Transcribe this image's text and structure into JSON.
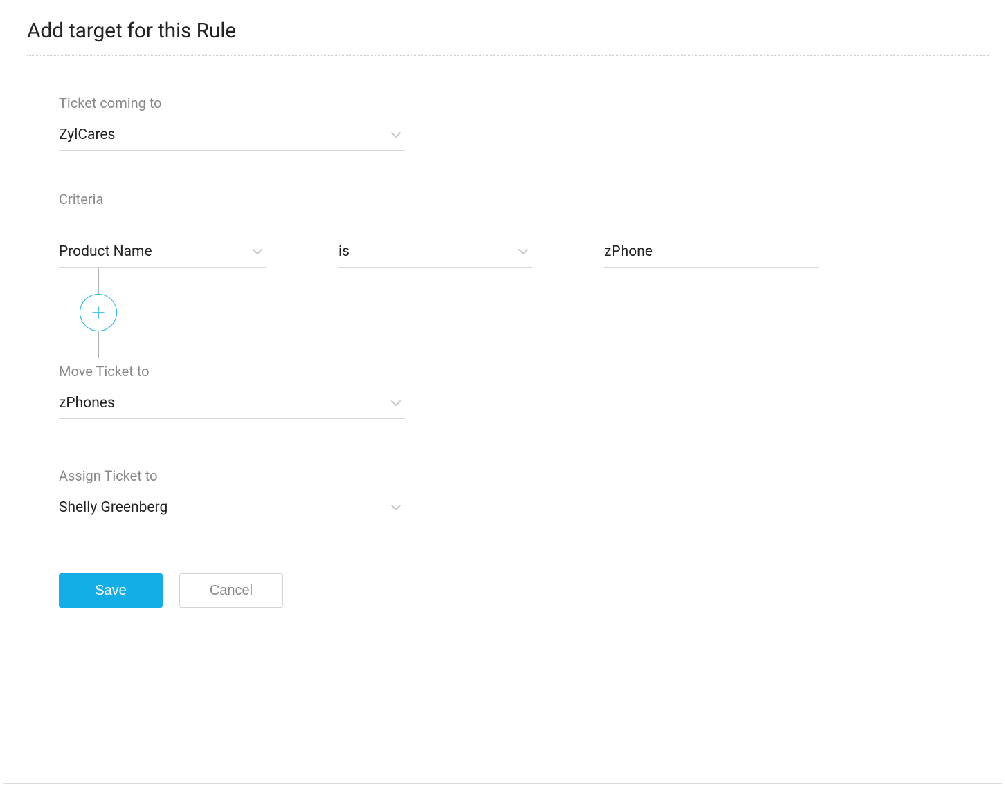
{
  "header": {
    "title": "Add target for this Rule"
  },
  "ticket_coming": {
    "label": "Ticket coming to",
    "value": "ZylCares"
  },
  "criteria": {
    "label": "Criteria",
    "field": "Product Name",
    "operator": "is",
    "value": "zPhone"
  },
  "move_ticket": {
    "label": "Move Ticket to",
    "value": "zPhones"
  },
  "assign_ticket": {
    "label": "Assign Ticket to",
    "value": "Shelly Greenberg"
  },
  "actions": {
    "save": "Save",
    "cancel": "Cancel"
  },
  "colors": {
    "accent": "#14aee6",
    "text_muted": "#888"
  }
}
